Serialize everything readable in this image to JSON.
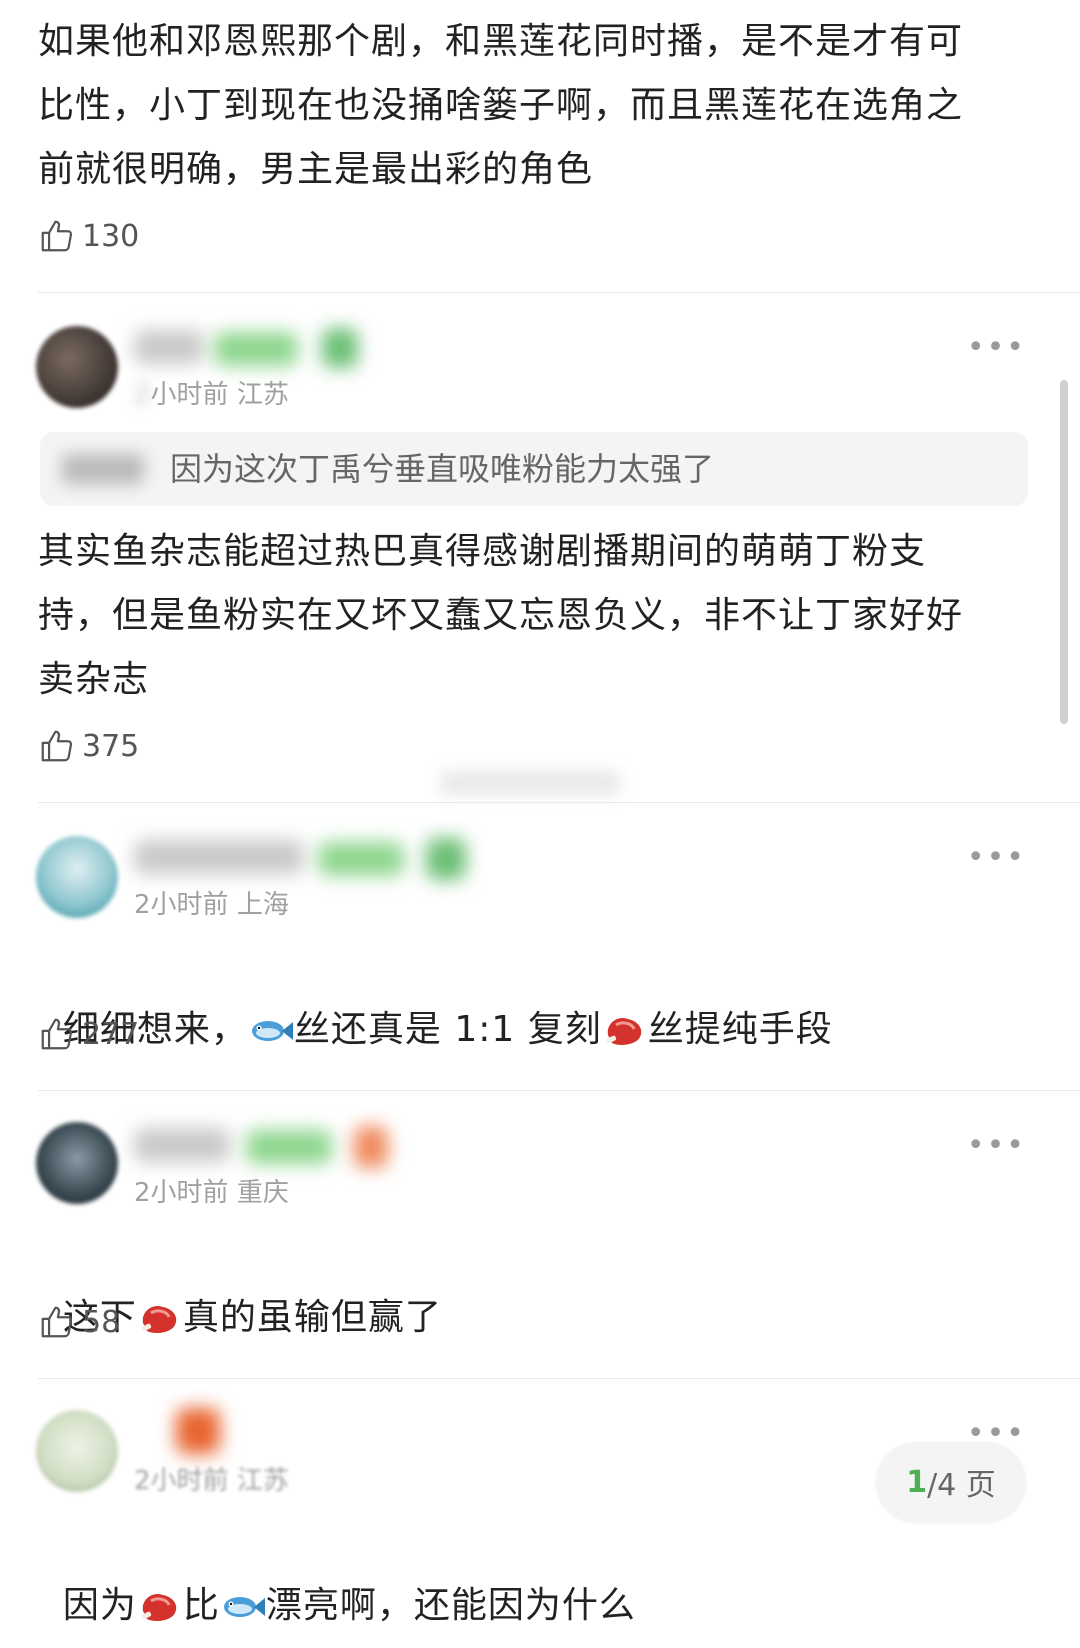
{
  "comments": [
    {
      "text": "如果他和邓恩熙那个剧，和黑莲花同时播，是不是才有可\n比性，小丁到现在也没捅啥篓子啊，而且黑莲花在选角之\n前就很明确，男主是最出彩的角色",
      "likes": "130"
    },
    {
      "meta_time": "小时前",
      "meta_loc": "江苏",
      "quote_text": "因为这次丁禹兮垂直吸唯粉能力太强了",
      "text": "其实鱼杂志能超过热巴真得感谢剧播期间的萌萌丁粉支\n持，但是鱼粉实在又坏又蠢又忘恩负义，非不让丁家好好\n卖杂志",
      "likes": "375",
      "more": "•••"
    },
    {
      "meta_time": "2小时前",
      "meta_loc": "上海",
      "text_a": "细细想来，",
      "text_b": "丝还真是 1:1 复刻",
      "text_c": "丝提纯手段",
      "likes": "277",
      "more": "•••"
    },
    {
      "meta_time": "2小时前",
      "meta_loc": "重庆",
      "text_a": "这下",
      "text_b": "真的虽输但赢了",
      "likes": "58",
      "more": "•••"
    },
    {
      "meta_time": "2小时前",
      "meta_loc": "江苏",
      "text_a": "因为",
      "text_b": "比",
      "text_c": "漂亮啊，还能因为什么",
      "more": "•••"
    }
  ],
  "pager": {
    "current": "1",
    "total": "/4 页"
  },
  "icons": {
    "like": "thumbs-up-icon",
    "fish": "fish-emoji-icon",
    "steak": "steak-emoji-icon"
  },
  "colors": {
    "accent": "#4caf50",
    "meta": "#a0a0a0"
  }
}
